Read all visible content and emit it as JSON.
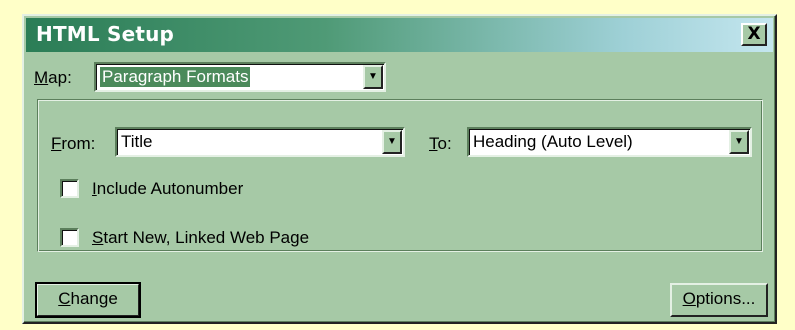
{
  "window": {
    "title": "HTML Setup",
    "close_label": "X"
  },
  "map": {
    "label_mnemonic": "M",
    "label_rest": "ap:",
    "value": "Paragraph Formats"
  },
  "from": {
    "label_mnemonic": "F",
    "label_rest": "rom:",
    "value": "Title"
  },
  "to": {
    "label_mnemonic": "T",
    "label_rest": "o:",
    "value": "Heading (Auto Level)"
  },
  "options": {
    "include_autonumber": {
      "label_mnemonic": "I",
      "label_rest": "nclude Autonumber",
      "checked": false
    },
    "start_new_page": {
      "label_mnemonic": "S",
      "label_rest": "tart New, Linked Web Page",
      "checked": false
    }
  },
  "buttons": {
    "change_mnemonic": "C",
    "change_rest": "hange",
    "options_mnemonic": "O",
    "options_rest": "ptions..."
  },
  "icons": {
    "dropdown": "dropdown-arrow-icon"
  }
}
